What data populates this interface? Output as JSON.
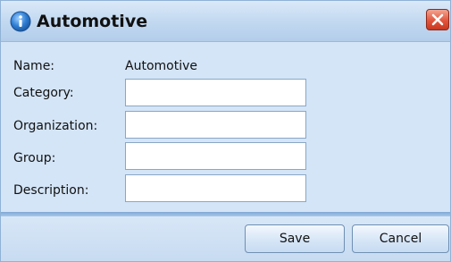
{
  "dialog": {
    "title": "Automotive",
    "close_label": "Close"
  },
  "form": {
    "name_label": "Name:",
    "name_value": "Automotive",
    "category_label": "Category:",
    "category_value": "",
    "organization_label": "Organization:",
    "organization_value": "",
    "group_label": "Group:",
    "group_value": "",
    "description_label": "Description:",
    "description_value": ""
  },
  "footer": {
    "save_label": "Save",
    "cancel_label": "Cancel"
  },
  "icons": {
    "title_icon": "info-icon",
    "close_icon": "close-icon"
  },
  "colors": {
    "background": "#d4e5f7",
    "close_button": "#e2553c"
  }
}
